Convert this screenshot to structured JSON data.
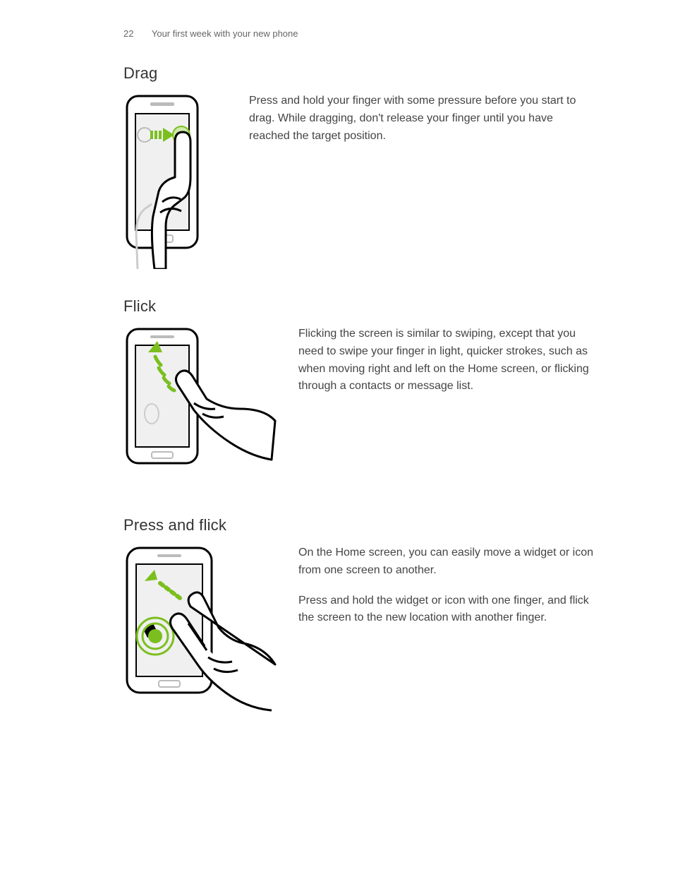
{
  "header": {
    "page_number": "22",
    "chapter": "Your first week with your new phone"
  },
  "sections": [
    {
      "title": "Drag",
      "paragraphs": [
        "Press and hold your finger with some pressure before you start to drag. While dragging, don't release your finger until you have reached the target position."
      ]
    },
    {
      "title": "Flick",
      "paragraphs": [
        "Flicking the screen is similar to swiping, except that you need to swipe your finger in light, quicker strokes, such as when moving right and left on the Home screen, or flicking through a contacts or message list."
      ]
    },
    {
      "title": "Press and flick",
      "paragraphs": [
        "On the Home screen, you can easily move a widget or icon from one screen to another.",
        "Press and hold the widget or icon with one finger, and flick the screen to the new location with another finger."
      ]
    }
  ],
  "accent_color": "#7bbf1e"
}
